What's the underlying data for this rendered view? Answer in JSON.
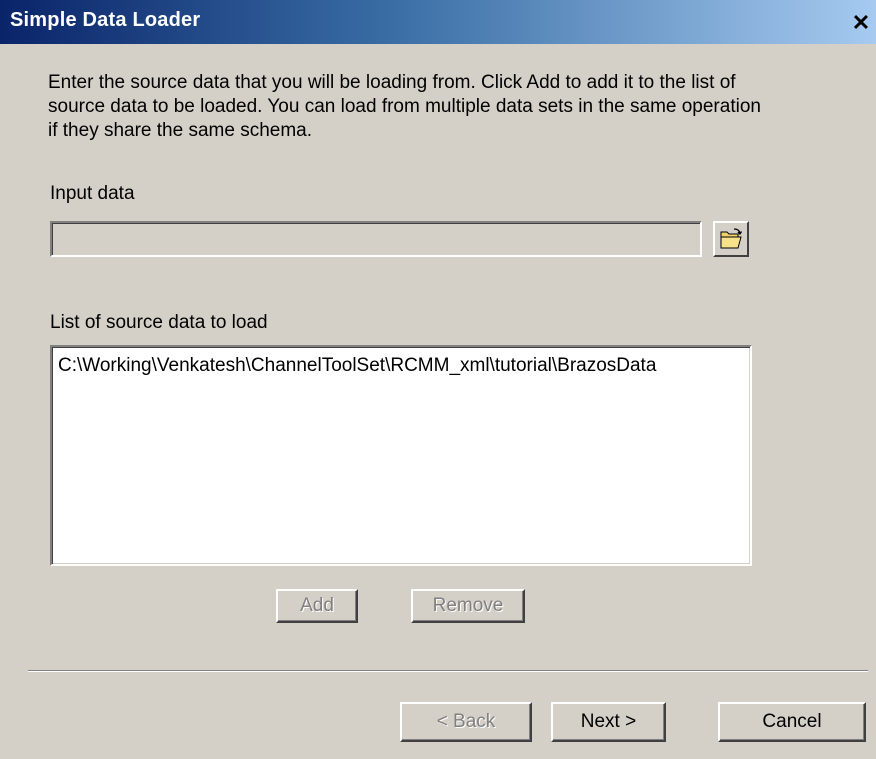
{
  "window": {
    "title": "Simple Data Loader",
    "close_glyph": "✕"
  },
  "instructions": "Enter the source data that you will be loading from. Click Add to add it to the list of source data to be loaded. You can load from multiple data sets in the same operation if they share the same schema.",
  "input": {
    "label": "Input data",
    "value": "",
    "browse_icon": "open-folder-icon"
  },
  "source_list": {
    "label": "List of source data to load",
    "items": [
      "C:\\Working\\Venkatesh\\ChannelToolSet\\RCMM_xml\\tutorial\\BrazosData"
    ]
  },
  "actions": {
    "add_label": "Add",
    "remove_label": "Remove"
  },
  "footer": {
    "back_label": "< Back",
    "next_label": "Next >",
    "cancel_label": "Cancel"
  },
  "colors": {
    "dialog_bg": "#d4d0c8",
    "title_start": "#0a246a",
    "title_end": "#a6caf0",
    "disabled_text": "#808080"
  }
}
